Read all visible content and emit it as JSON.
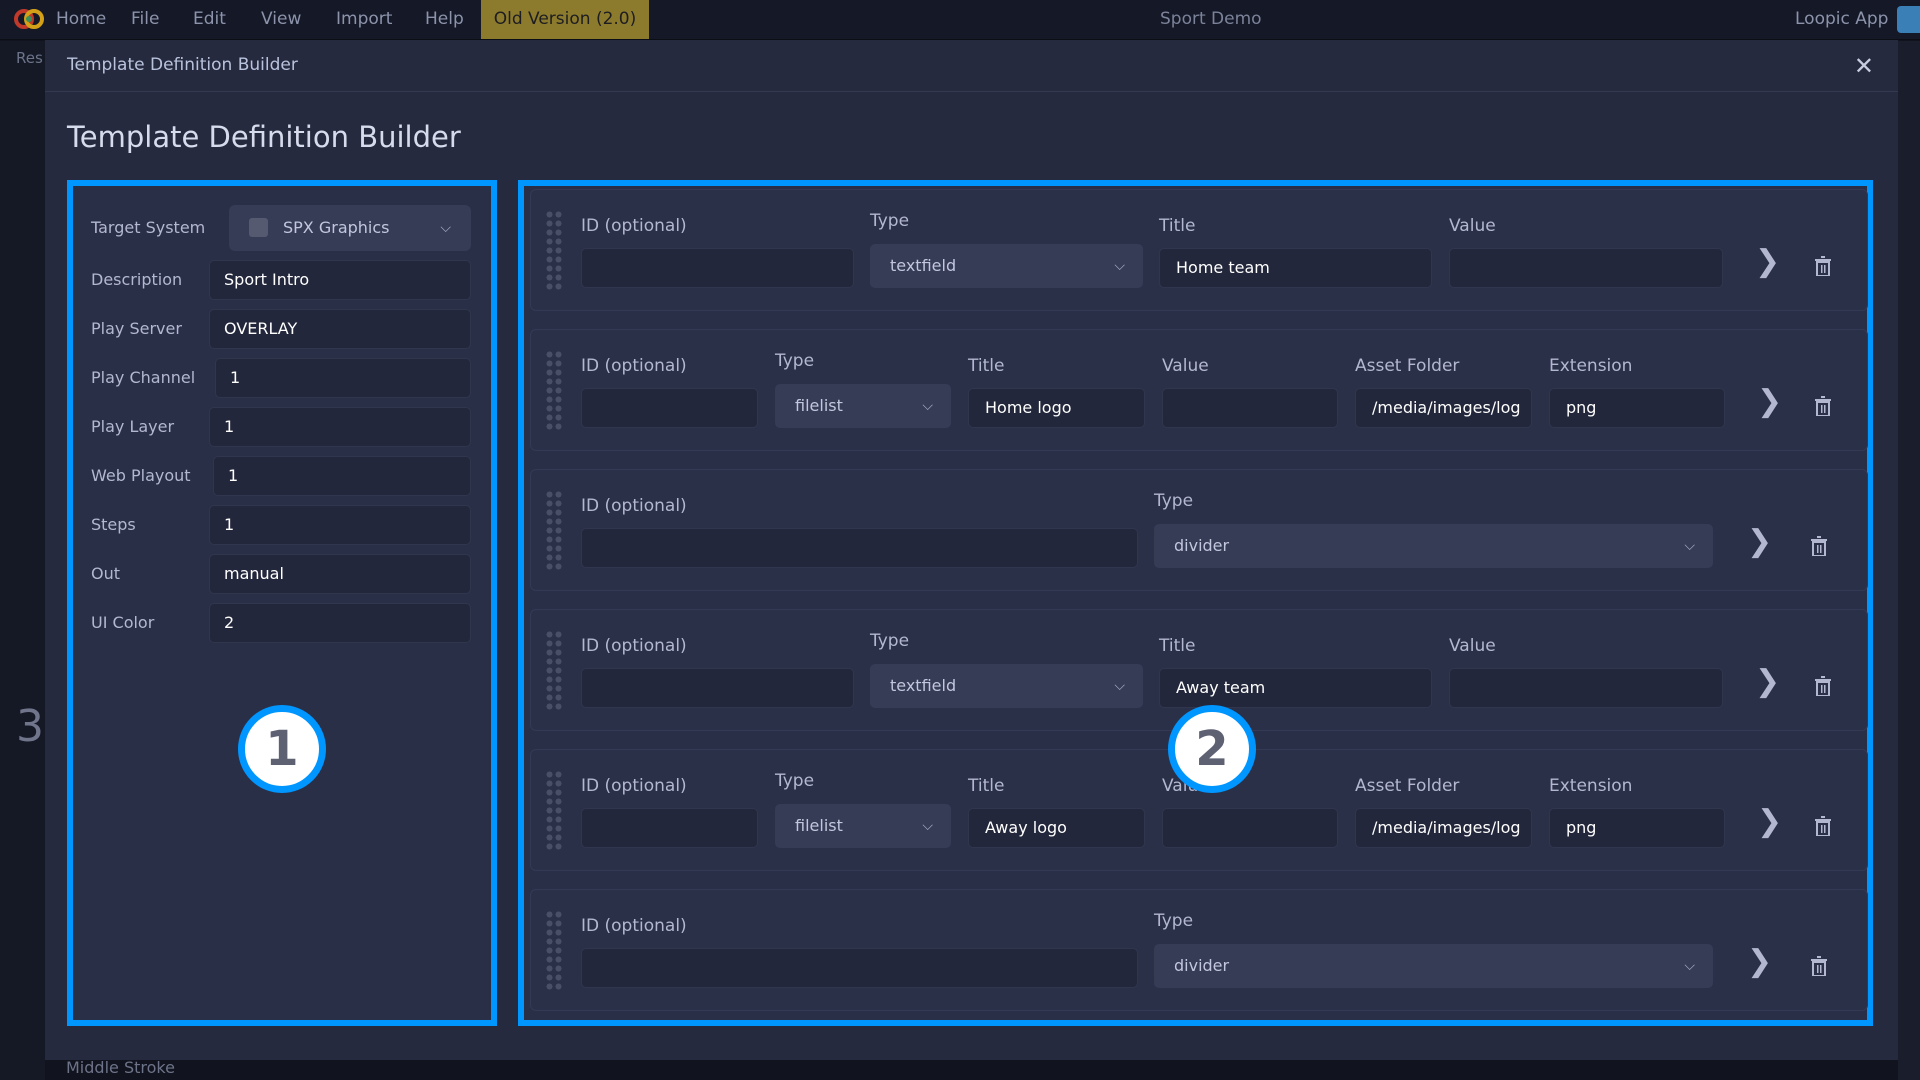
{
  "menubar": {
    "items": [
      "Home",
      "File",
      "Edit",
      "View",
      "Import",
      "Help"
    ],
    "old_version": "Old Version (2.0)",
    "project": "Sport Demo",
    "app": "Loopic App"
  },
  "sidebar": {
    "header": "Res",
    "bottom_item": "Middle Stroke",
    "big_digit": "3"
  },
  "modal": {
    "header_title": "Template Definition Builder",
    "title": "Template Definition Builder"
  },
  "settings": {
    "target_system_label": "Target System",
    "target_system": "SPX Graphics",
    "target_icon_text": "SPX",
    "fields": [
      {
        "label": "Description",
        "value": "Sport Intro"
      },
      {
        "label": "Play Server",
        "value": "OVERLAY"
      },
      {
        "label": "Play Channel",
        "value": "1"
      },
      {
        "label": "Play Layer",
        "value": "1"
      },
      {
        "label": "Web Playout",
        "value": "1"
      },
      {
        "label": "Steps",
        "value": "1"
      },
      {
        "label": "Out",
        "value": "manual"
      },
      {
        "label": "UI Color",
        "value": "2"
      }
    ]
  },
  "labels": {
    "id": "ID (optional)",
    "type": "Type",
    "title": "Title",
    "value": "Value",
    "asset": "Asset Folder",
    "ext": "Extension"
  },
  "rows": [
    {
      "type": "textfield",
      "id": "",
      "title": "Home team",
      "value": ""
    },
    {
      "type": "filelist",
      "id": "",
      "title": "Home logo",
      "value": "",
      "asset": "/media/images/log",
      "ext": "png"
    },
    {
      "type": "divider",
      "id": ""
    },
    {
      "type": "textfield",
      "id": "",
      "title": "Away team",
      "value": ""
    },
    {
      "type": "filelist",
      "id": "",
      "title": "Away logo",
      "value": "",
      "asset": "/media/images/log",
      "ext": "png"
    },
    {
      "type": "divider",
      "id": ""
    }
  ],
  "badges": [
    "1",
    "2"
  ],
  "colors": {
    "highlight": "#0096ff",
    "old_version": "#8d7b2d",
    "modal_bg": "#262a3f"
  }
}
